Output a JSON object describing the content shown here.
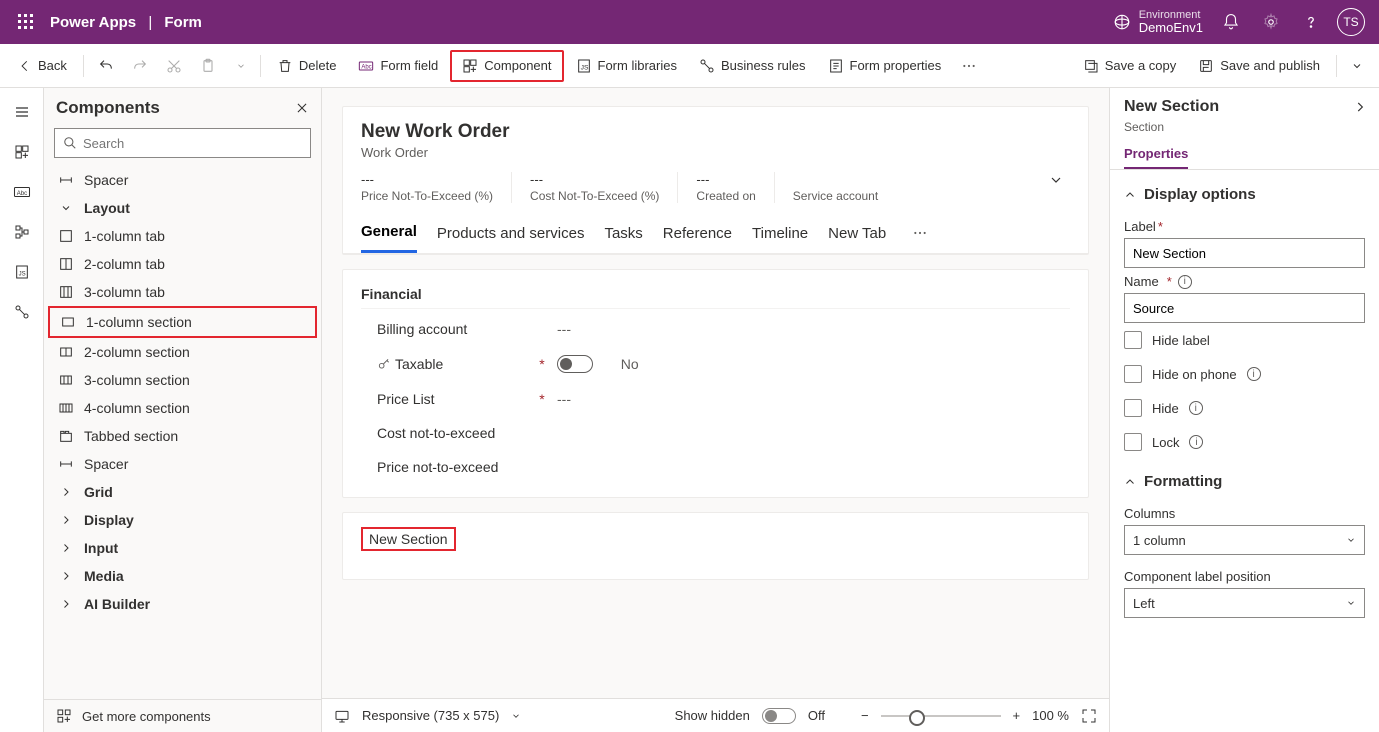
{
  "topbar": {
    "brand_app": "Power Apps",
    "brand_page": "Form",
    "env_label": "Environment",
    "env_name": "DemoEnv1",
    "avatar_initials": "TS"
  },
  "cmdbar": {
    "back": "Back",
    "delete": "Delete",
    "form_field": "Form field",
    "component": "Component",
    "form_libraries": "Form libraries",
    "business_rules": "Business rules",
    "form_properties": "Form properties",
    "save_copy": "Save a copy",
    "save_publish": "Save and publish"
  },
  "leftpanel": {
    "title": "Components",
    "search_placeholder": "Search",
    "items": [
      {
        "type": "item",
        "label": "Spacer",
        "icon": "spacer"
      },
      {
        "type": "group",
        "label": "Layout",
        "icon": "chev-down"
      },
      {
        "type": "item",
        "label": "1-column tab",
        "icon": "col1t"
      },
      {
        "type": "item",
        "label": "2-column tab",
        "icon": "col2t"
      },
      {
        "type": "item",
        "label": "3-column tab",
        "icon": "col3t"
      },
      {
        "type": "item",
        "label": "1-column section",
        "icon": "col1s",
        "highlight": true
      },
      {
        "type": "item",
        "label": "2-column section",
        "icon": "col2s"
      },
      {
        "type": "item",
        "label": "3-column section",
        "icon": "col3s"
      },
      {
        "type": "item",
        "label": "4-column section",
        "icon": "col4s"
      },
      {
        "type": "item",
        "label": "Tabbed section",
        "icon": "tabbed"
      },
      {
        "type": "item",
        "label": "Spacer",
        "icon": "spacer"
      },
      {
        "type": "group",
        "label": "Grid",
        "icon": "chev-right"
      },
      {
        "type": "group",
        "label": "Display",
        "icon": "chev-right"
      },
      {
        "type": "group",
        "label": "Input",
        "icon": "chev-right"
      },
      {
        "type": "group",
        "label": "Media",
        "icon": "chev-right"
      },
      {
        "type": "group",
        "label": "AI Builder",
        "icon": "chev-right"
      }
    ],
    "footer": "Get more components"
  },
  "form": {
    "title": "New Work Order",
    "subtitle": "Work Order",
    "header_fields": [
      {
        "value": "---",
        "label": "Price Not-To-Exceed (%)"
      },
      {
        "value": "---",
        "label": "Cost Not-To-Exceed (%)"
      },
      {
        "value": "---",
        "label": "Created on"
      },
      {
        "value": "",
        "label": "Service account"
      }
    ],
    "tabs": [
      "General",
      "Products and services",
      "Tasks",
      "Reference",
      "Timeline",
      "New Tab"
    ],
    "active_tab": 0,
    "section_financial": {
      "title": "Financial",
      "rows": [
        {
          "label": "Billing account",
          "required": false,
          "value": "---",
          "icon": ""
        },
        {
          "label": "Taxable",
          "required": true,
          "value": "No",
          "icon": "key",
          "toggle": true
        },
        {
          "label": "Price List",
          "required": true,
          "value": "---",
          "icon": ""
        },
        {
          "label": "Cost not-to-exceed",
          "required": false,
          "value": "",
          "icon": ""
        },
        {
          "label": "Price not-to-exceed",
          "required": false,
          "value": "",
          "icon": ""
        }
      ]
    },
    "new_section_title": "New Section"
  },
  "canvas_footer": {
    "responsive": "Responsive (735 x 575)",
    "show_hidden": "Show hidden",
    "off": "Off",
    "zoom_pct": "100 %"
  },
  "rpanel": {
    "title": "New Section",
    "subtitle": "Section",
    "tab": "Properties",
    "display_options": "Display options",
    "label_label": "Label",
    "label_value": "New Section",
    "name_label": "Name",
    "name_value": "Source",
    "hide_label": "Hide label",
    "hide_phone": "Hide on phone",
    "hide": "Hide",
    "lock": "Lock",
    "formatting": "Formatting",
    "columns_label": "Columns",
    "columns_value": "1 column",
    "clp_label": "Component label position",
    "clp_value": "Left"
  }
}
